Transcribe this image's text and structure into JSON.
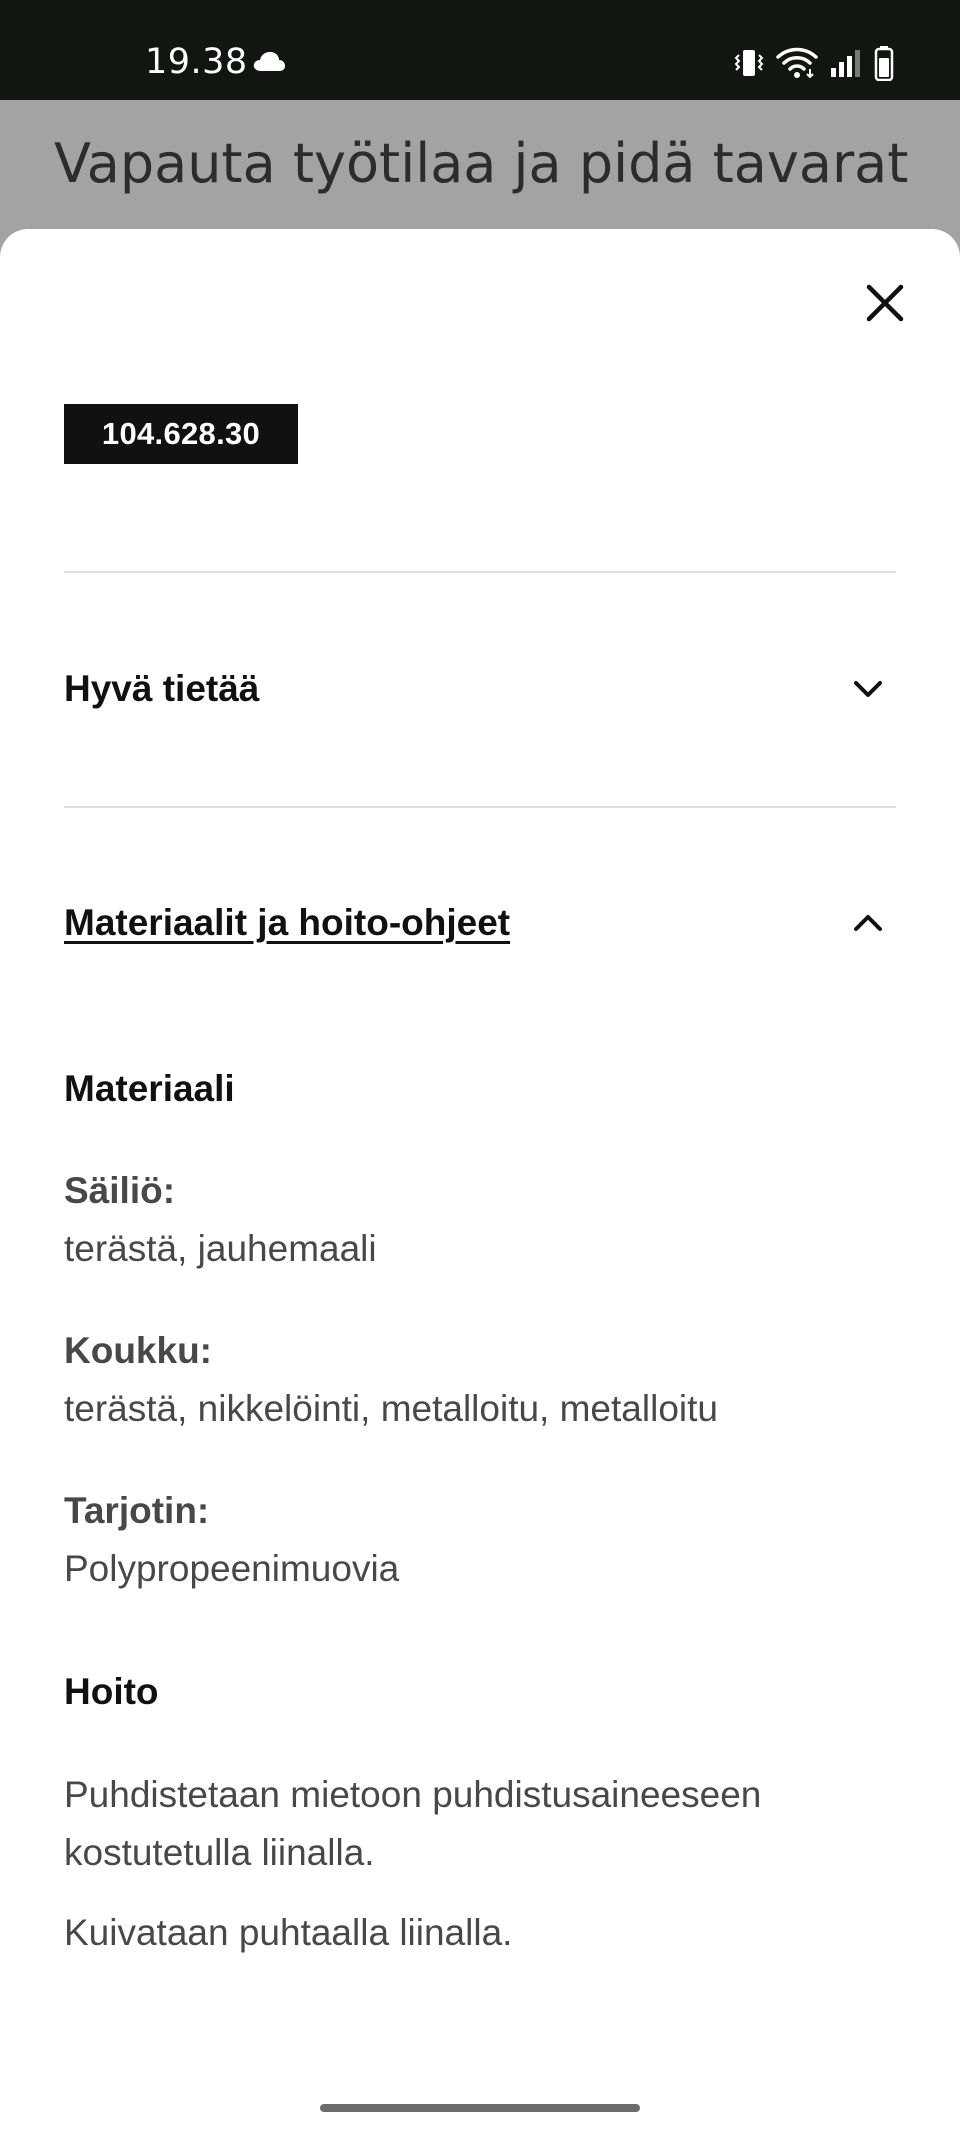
{
  "status_bar": {
    "time": "19.38",
    "icons": [
      "cloud-icon",
      "vibrate-icon",
      "wifi-icon",
      "signal-icon",
      "battery-icon"
    ]
  },
  "backdrop": {
    "title": "Vapauta työtilaa ja pidä tavarat"
  },
  "sheet": {
    "close_icon": "close-icon",
    "article_number": "104.628.30",
    "accordions": [
      {
        "title": "Hyvä tietää",
        "expanded": false,
        "icon": "chevron-down-icon"
      },
      {
        "title": "Materiaalit ja hoito-ohjeet",
        "expanded": true,
        "icon": "chevron-up-icon"
      }
    ],
    "materials": {
      "heading": "Materiaali",
      "items": [
        {
          "label": "Säiliö:",
          "value": "terästä, jauhemaali"
        },
        {
          "label": "Koukku:",
          "value": "terästä, nikkelöinti, metalloitu, metalloitu"
        },
        {
          "label": "Tarjotin:",
          "value": "Polypropeenimuovia"
        }
      ]
    },
    "care": {
      "heading": "Hoito",
      "paragraphs": [
        "Puhdistetaan mietoon puhdistusaineeseen kostutetulla liinalla.",
        "Kuivataan puhtaalla liinalla."
      ]
    }
  },
  "colors": {
    "status_bar_bg": "#111611",
    "backdrop": "#a3a3a3",
    "sheet_bg": "#ffffff",
    "badge_bg": "#111111",
    "text_primary": "#111111",
    "text_secondary": "#484848"
  }
}
